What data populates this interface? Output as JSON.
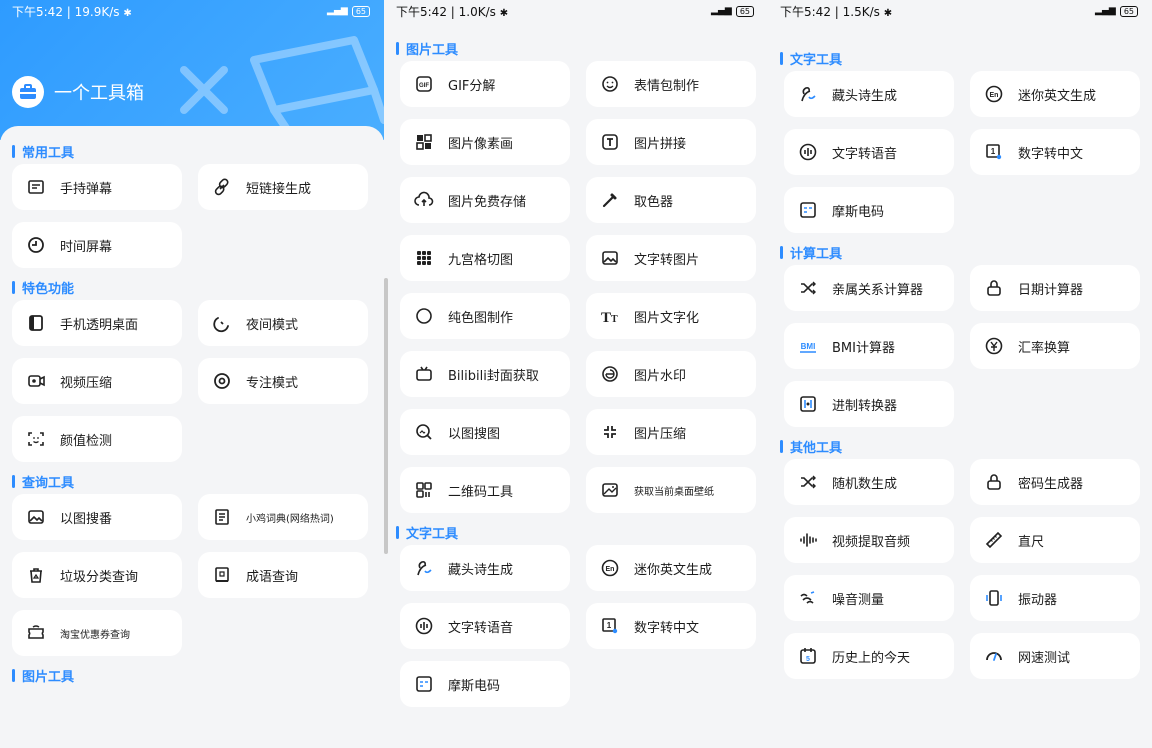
{
  "panel1": {
    "status": {
      "time": "下午5:42",
      "speed": "19.9K/s",
      "battery": "65"
    },
    "app_title": "一个工具箱",
    "sections": [
      {
        "title": "常用工具",
        "items": [
          {
            "label": "手持弹幕",
            "icon": "screen-icon"
          },
          {
            "label": "短链接生成",
            "icon": "link-icon"
          },
          {
            "label": "时间屏幕",
            "icon": "clock-icon"
          }
        ]
      },
      {
        "title": "特色功能",
        "items": [
          {
            "label": "手机透明桌面",
            "icon": "phone-icon"
          },
          {
            "label": "夜间模式",
            "icon": "moon-icon"
          },
          {
            "label": "视频压缩",
            "icon": "video-icon"
          },
          {
            "label": "专注模式",
            "icon": "target-icon"
          },
          {
            "label": "颜值检测",
            "icon": "face-scan-icon"
          }
        ]
      },
      {
        "title": "查询工具",
        "items": [
          {
            "label": "以图搜番",
            "icon": "image-icon"
          },
          {
            "label": "小鸡词典(网络热词)",
            "icon": "book-icon",
            "small": true
          },
          {
            "label": "垃圾分类查询",
            "icon": "trash-icon"
          },
          {
            "label": "成语查询",
            "icon": "dictionary-icon"
          },
          {
            "label": "淘宝优惠券查询",
            "icon": "coupon-icon",
            "small": true
          }
        ]
      },
      {
        "title": "图片工具",
        "items": []
      }
    ]
  },
  "panel2": {
    "status": {
      "time": "下午5:42",
      "speed": "1.0K/s",
      "battery": "65"
    },
    "sections": [
      {
        "title": "图片工具",
        "items": [
          {
            "label": "GIF分解",
            "icon": "gif-icon"
          },
          {
            "label": "表情包制作",
            "icon": "smile-icon"
          },
          {
            "label": "图片像素画",
            "icon": "pixel-icon"
          },
          {
            "label": "图片拼接",
            "icon": "text-frame-icon"
          },
          {
            "label": "图片免费存储",
            "icon": "cloud-upload-icon"
          },
          {
            "label": "取色器",
            "icon": "eyedropper-icon"
          },
          {
            "label": "九宫格切图",
            "icon": "grid-icon"
          },
          {
            "label": "文字转图片",
            "icon": "image-icon"
          },
          {
            "label": "纯色图制作",
            "icon": "circle-icon"
          },
          {
            "label": "图片文字化",
            "icon": "text-size-icon"
          },
          {
            "label": "Bilibili封面获取",
            "icon": "tv-icon"
          },
          {
            "label": "图片水印",
            "icon": "watermark-icon"
          },
          {
            "label": "以图搜图",
            "icon": "search-image-icon"
          },
          {
            "label": "图片压缩",
            "icon": "compress-icon"
          },
          {
            "label": "二维码工具",
            "icon": "qrcode-icon"
          },
          {
            "label": "获取当前桌面壁纸",
            "icon": "wallpaper-icon",
            "small": true
          }
        ]
      },
      {
        "title": "文字工具",
        "items": [
          {
            "label": "藏头诗生成",
            "icon": "poem-icon"
          },
          {
            "label": "迷你英文生成",
            "icon": "en-icon"
          },
          {
            "label": "文字转语音",
            "icon": "voice-icon"
          },
          {
            "label": "数字转中文",
            "icon": "number-icon"
          },
          {
            "label": "摩斯电码",
            "icon": "morse-icon"
          }
        ]
      }
    ]
  },
  "panel3": {
    "status": {
      "time": "下午5:42",
      "speed": "1.5K/s",
      "battery": "65"
    },
    "sections": [
      {
        "title": "文字工具",
        "items": [
          {
            "label": "藏头诗生成",
            "icon": "poem-icon"
          },
          {
            "label": "迷你英文生成",
            "icon": "en-icon"
          },
          {
            "label": "文字转语音",
            "icon": "voice-icon"
          },
          {
            "label": "数字转中文",
            "icon": "number-icon"
          },
          {
            "label": "摩斯电码",
            "icon": "morse-icon"
          }
        ]
      },
      {
        "title": "计算工具",
        "items": [
          {
            "label": "亲属关系计算器",
            "icon": "shuffle-icon"
          },
          {
            "label": "日期计算器",
            "icon": "lock-icon"
          },
          {
            "label": "BMI计算器",
            "icon": "bmi-icon"
          },
          {
            "label": "汇率换算",
            "icon": "currency-icon"
          },
          {
            "label": "进制转换器",
            "icon": "binary-icon"
          }
        ]
      },
      {
        "title": "其他工具",
        "items": [
          {
            "label": "随机数生成",
            "icon": "shuffle-icon"
          },
          {
            "label": "密码生成器",
            "icon": "lock-icon"
          },
          {
            "label": "视频提取音频",
            "icon": "audio-wave-icon"
          },
          {
            "label": "直尺",
            "icon": "ruler-icon"
          },
          {
            "label": "噪音测量",
            "icon": "noise-icon"
          },
          {
            "label": "振动器",
            "icon": "vibrate-icon"
          },
          {
            "label": "历史上的今天",
            "icon": "calendar-icon"
          },
          {
            "label": "网速测试",
            "icon": "speed-icon"
          }
        ]
      }
    ]
  },
  "colors": {
    "accent": "#2d8cff",
    "hero": "#3aa3ff",
    "tile": "#ffffff",
    "bg": "#f4f5f7",
    "text": "#1c1c1c"
  }
}
